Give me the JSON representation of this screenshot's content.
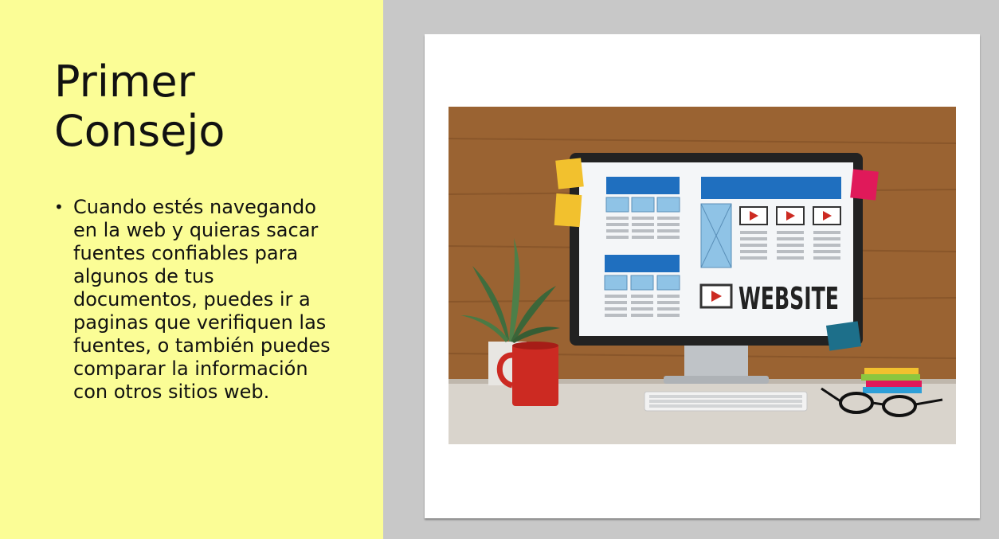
{
  "slide": {
    "title": "Primer Consejo",
    "bullets": [
      "Cuando estés navegando en la web y quieras sacar fuentes confiables para algunos de tus documentos, puedes ir a paginas que verifiquen las fuentes, o también puedes comparar la información con otros sitios web."
    ]
  },
  "image": {
    "screen_word": "WEBSITE",
    "icons": [
      "monitor-icon",
      "plant-icon",
      "mug-icon",
      "keyboard-icon",
      "glasses-icon",
      "sticky-note-icon"
    ]
  },
  "colors": {
    "left_background": "#fbfd96",
    "right_background": "#c8c8c8",
    "card_background": "#ffffff",
    "wood": "#9a6332",
    "accent_blue": "#1f6fbf",
    "mug_red": "#cc2a22"
  }
}
